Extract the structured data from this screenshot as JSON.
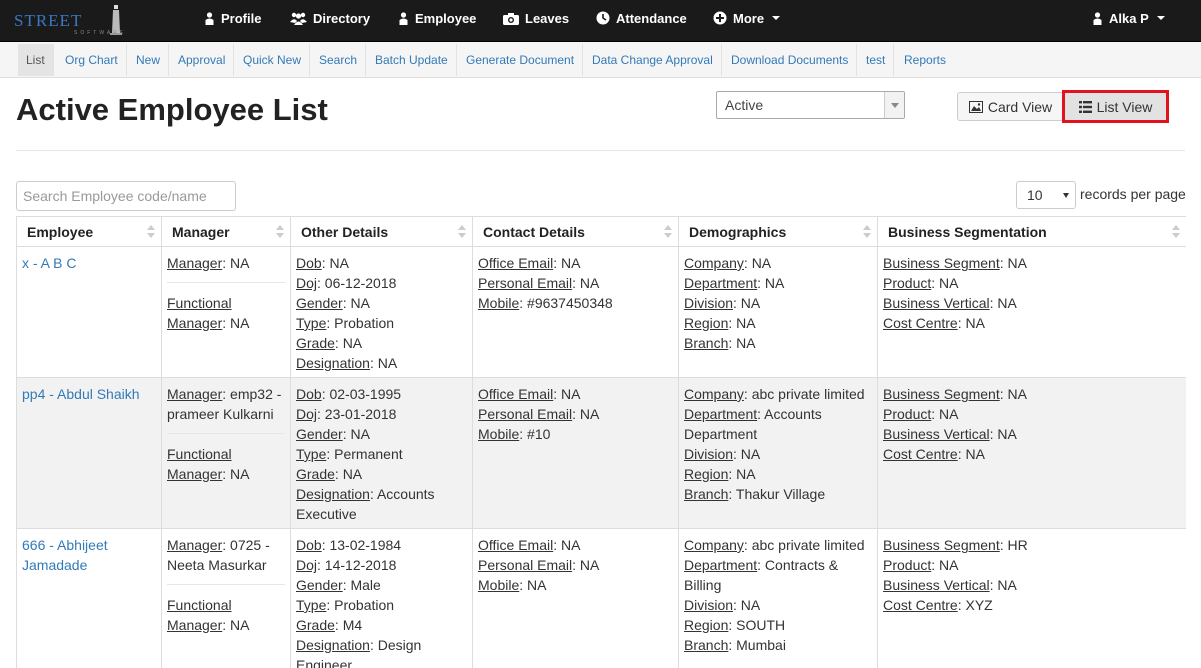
{
  "topnav": {
    "logo_text": "STREET",
    "logo_sub": "SOFTWARE",
    "items": [
      {
        "label": "Profile",
        "icon": "user-icon"
      },
      {
        "label": "Directory",
        "icon": "users-icon"
      },
      {
        "label": "Employee",
        "icon": "user-icon"
      },
      {
        "label": "Leaves",
        "icon": "camera-icon"
      },
      {
        "label": "Attendance",
        "icon": "clock-icon"
      },
      {
        "label": "More",
        "icon": "plus-circle-icon"
      }
    ],
    "user": "Alka P"
  },
  "subnav": [
    "List",
    "Org Chart",
    "New",
    "Approval",
    "Quick New",
    "Search",
    "Batch Update",
    "Generate Document",
    "Data Change Approval",
    "Download Documents",
    "test",
    "Reports"
  ],
  "header": {
    "title": "Active Employee List",
    "status_value": "Active",
    "card_view_label": "Card View",
    "list_view_label": "List View"
  },
  "controls": {
    "search_placeholder": "Search Employee code/name",
    "records_value": "10",
    "records_label": "records per page"
  },
  "table": {
    "columns": [
      "Employee",
      "Manager",
      "Other Details",
      "Contact Details",
      "Demographics",
      "Business Segmentation"
    ],
    "rows": [
      {
        "employee": "x - A B C",
        "manager": {
          "k1": "Manager",
          "v1": ": NA",
          "k2a": "Functional",
          "k2b": "Manager",
          "v2": ": NA"
        },
        "other": [
          [
            "Dob",
            ": NA"
          ],
          [
            "Doj",
            ": 06-12-2018"
          ],
          [
            "Gender",
            ": NA"
          ],
          [
            "Type",
            ": Probation"
          ],
          [
            "Grade",
            ": NA"
          ],
          [
            "Designation",
            ": NA"
          ]
        ],
        "contact": [
          [
            "Office Email",
            ": NA"
          ],
          [
            "Personal Email",
            ": NA"
          ],
          [
            "Mobile",
            ": #9637450348"
          ]
        ],
        "demo": [
          [
            "Company",
            ": NA"
          ],
          [
            "Department",
            ": NA"
          ],
          [
            "Division",
            ": NA"
          ],
          [
            "Region",
            ": NA"
          ],
          [
            "Branch",
            ": NA"
          ]
        ],
        "biz": [
          [
            "Business Segment",
            ": NA"
          ],
          [
            "Product",
            ": NA"
          ],
          [
            "Business Vertical",
            ": NA"
          ],
          [
            "Cost Centre",
            ": NA"
          ]
        ]
      },
      {
        "employee": "pp4 - Abdul Shaikh",
        "manager": {
          "k1": "Manager",
          "v1": ": emp32 - prameer Kulkarni",
          "k2a": "Functional",
          "k2b": "Manager",
          "v2": ": NA"
        },
        "other": [
          [
            "Dob",
            ": 02-03-1995"
          ],
          [
            "Doj",
            ": 23-01-2018"
          ],
          [
            "Gender",
            ": NA"
          ],
          [
            "Type",
            ": Permanent"
          ],
          [
            "Grade",
            ": NA"
          ],
          [
            "Designation",
            ": Accounts Executive"
          ]
        ],
        "contact": [
          [
            "Office Email",
            ": NA"
          ],
          [
            "Personal Email",
            ": NA"
          ],
          [
            "Mobile",
            ": #10"
          ]
        ],
        "demo": [
          [
            "Company",
            ": abc private limited"
          ],
          [
            "Department",
            ": Accounts Department"
          ],
          [
            "Division",
            ": NA"
          ],
          [
            "Region",
            ": NA"
          ],
          [
            "Branch",
            ": Thakur Village"
          ]
        ],
        "biz": [
          [
            "Business Segment",
            ": NA"
          ],
          [
            "Product",
            ": NA"
          ],
          [
            "Business Vertical",
            ": NA"
          ],
          [
            "Cost Centre",
            ": NA"
          ]
        ]
      },
      {
        "employee": "666 - Abhijeet Jamadade",
        "manager": {
          "k1": "Manager",
          "v1": ": 0725 - Neeta Masurkar",
          "k2a": "Functional",
          "k2b": "Manager",
          "v2": ": NA"
        },
        "other": [
          [
            "Dob",
            ": 13-02-1984"
          ],
          [
            "Doj",
            ": 14-12-2018"
          ],
          [
            "Gender",
            ": Male"
          ],
          [
            "Type",
            ": Probation"
          ],
          [
            "Grade",
            ": M4"
          ],
          [
            "Designation",
            ": Design Engineer"
          ]
        ],
        "contact": [
          [
            "Office Email",
            ": NA"
          ],
          [
            "Personal Email",
            ": NA"
          ],
          [
            "Mobile",
            ": NA"
          ]
        ],
        "demo": [
          [
            "Company",
            ": abc private limited"
          ],
          [
            "Department",
            ": Contracts & Billing"
          ],
          [
            "Division",
            ": NA"
          ],
          [
            "Region",
            ": SOUTH"
          ],
          [
            "Branch",
            ": Mumbai"
          ]
        ],
        "biz": [
          [
            "Business Segment",
            ": HR"
          ],
          [
            "Product",
            ": NA"
          ],
          [
            "Business Vertical",
            ": NA"
          ],
          [
            "Cost Centre",
            ": XYZ"
          ]
        ]
      }
    ]
  }
}
